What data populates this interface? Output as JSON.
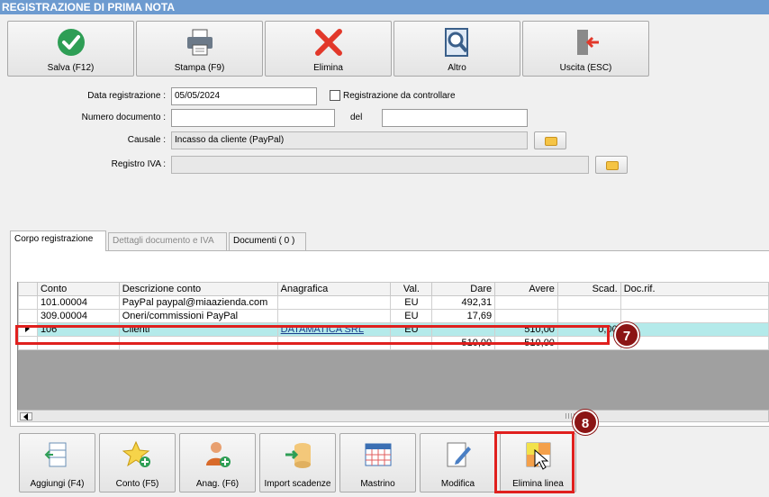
{
  "window": {
    "title": "REGISTRAZIONE DI PRIMA NOTA"
  },
  "toolbar": {
    "buttons": [
      {
        "label": "Salva (F12)",
        "icon": "check-icon"
      },
      {
        "label": "Stampa (F9)",
        "icon": "printer-icon"
      },
      {
        "label": "Elimina",
        "icon": "delete-x-icon"
      },
      {
        "label": "Altro",
        "icon": "magnifier-icon"
      },
      {
        "label": "Uscita (ESC)",
        "icon": "exit-door-icon"
      }
    ]
  },
  "form": {
    "data_registrazione": {
      "label": "Data registrazione :",
      "value": "05/05/2024"
    },
    "registrazione_da_controllare": {
      "label": "Registrazione da controllare",
      "checked": false
    },
    "numero_documento": {
      "label": "Numero documento :",
      "value": ""
    },
    "del": {
      "label": "del",
      "value": ""
    },
    "causale": {
      "label": "Causale :",
      "value": "Incasso da cliente (PayPal)"
    },
    "registro_iva": {
      "label": "Registro IVA :",
      "value": ""
    }
  },
  "tabs": [
    {
      "label": "Corpo registrazione",
      "state": "active"
    },
    {
      "label": "Dettagli documento e IVA",
      "state": "disabled"
    },
    {
      "label": "Documenti ( 0 )",
      "state": "normal"
    }
  ],
  "grid": {
    "columns": [
      "Conto",
      "Descrizione conto",
      "Anagrafica",
      "Val.",
      "Dare",
      "Avere",
      "Scad.",
      "Doc.rif."
    ],
    "rows": [
      {
        "conto": "101.00004",
        "descrizione": "PayPal paypal@miaazienda.com",
        "anagrafica": "",
        "val": "EU",
        "dare": "492,31",
        "avere": "",
        "scad": "",
        "docrif": ""
      },
      {
        "conto": "309.00004",
        "descrizione": "Oneri/commissioni PayPal",
        "anagrafica": "",
        "val": "EU",
        "dare": "17,69",
        "avere": "",
        "scad": "",
        "docrif": ""
      },
      {
        "conto": "106",
        "descrizione": "Clienti",
        "anagrafica": "DATAMATICA SRL",
        "val": "EU",
        "dare": "",
        "avere": "510,00",
        "scad": "0,00",
        "docrif": ""
      }
    ],
    "totals": {
      "dare": "510,00",
      "avere": "510,00"
    }
  },
  "bottom_buttons": [
    {
      "label": "Aggiungi (F4)",
      "icon": "add-row-icon"
    },
    {
      "label": "Conto (F5)",
      "icon": "star-add-icon"
    },
    {
      "label": "Anag. (F6)",
      "icon": "user-add-icon"
    },
    {
      "label": "Import scadenze",
      "icon": "import-icon"
    },
    {
      "label": "Mastrino",
      "icon": "calendar-grid-icon"
    },
    {
      "label": "Modifica",
      "icon": "edit-icon"
    },
    {
      "label": "Elimina linea",
      "icon": "delete-row-icon"
    }
  ],
  "annotations": [
    {
      "number": "7",
      "color": "#8b1414"
    },
    {
      "number": "8",
      "color": "#8b1414"
    }
  ],
  "colors": {
    "title_bar": "#6d9bd0",
    "row_highlight": "#b4eaea",
    "annotation_border": "#e0201e"
  }
}
